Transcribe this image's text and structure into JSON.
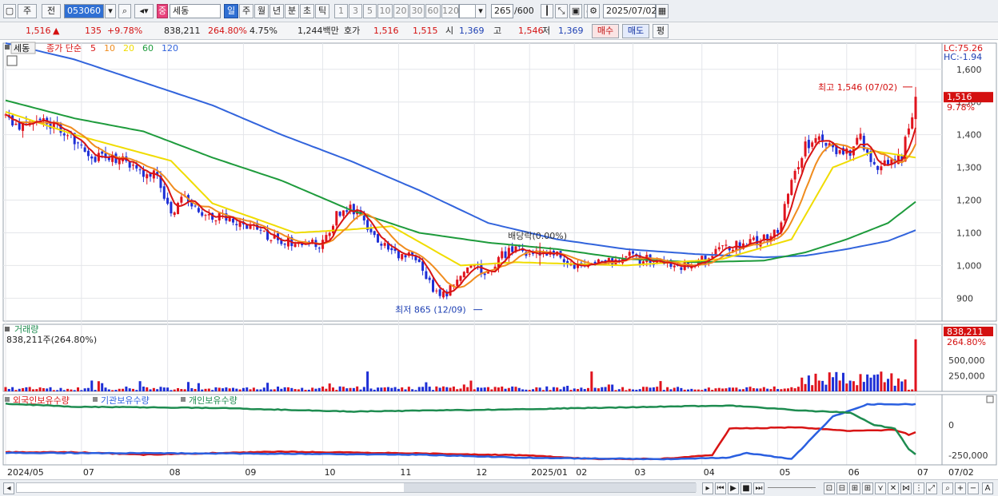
{
  "toolbar": {
    "period_label": "주",
    "all_label": "전",
    "code": "053060",
    "stock_name": "세동",
    "tf": [
      "일",
      "주",
      "월",
      "년",
      "분",
      "초",
      "틱"
    ],
    "tf_active": 0,
    "nums": [
      "1",
      "3",
      "5",
      "10",
      "20",
      "30",
      "60",
      "120"
    ],
    "count": "265",
    "count_total": "/600",
    "date": "2025/07/02"
  },
  "info": {
    "price": "1,516",
    "change_arrow": "▲",
    "change": "135",
    "change_pct": "+9.78%",
    "volume": "838,211",
    "vol_ratio": "264.80%",
    "turnover": "4.75%",
    "amount": "1,244백만",
    "quote_label": "호가",
    "ask": "1,516",
    "bid": "1,515",
    "open_label": "시",
    "open": "1,369",
    "high_label": "고",
    "high": "1,546",
    "low_label": "저",
    "low": "1,369",
    "buy_label": "매수",
    "sell_label": "매도",
    "flat_label": "평"
  },
  "colors": {
    "candle_up": "#e0141e",
    "candle_down": "#1e2fd6",
    "ma5": "#d81414",
    "ma10": "#f08c1e",
    "ma20": "#f0dc00",
    "ma60": "#1e9b3c",
    "ma120": "#3264dc",
    "foreign": "#d81414",
    "institution": "#2a5fe0",
    "individual": "#1e8c50"
  },
  "chart_data": [
    {
      "type": "candlestick",
      "legend": {
        "stock": "세동",
        "ma_title": "종가 단순",
        "ma": [
          "5",
          "10",
          "20",
          "60",
          "120"
        ]
      },
      "right_top_labels": [
        "LC:75.26",
        "HC:-1.94"
      ],
      "ylim": [
        830,
        1680
      ],
      "y_ticks": [
        900,
        1000,
        1100,
        1200,
        1300,
        1400,
        1500,
        1600
      ],
      "y_tick_labels": [
        "900",
        "1,000",
        "1,100",
        "1,200",
        "1,300",
        "1,400",
        "1,500",
        "1,600"
      ],
      "current_price": {
        "label": "1,516",
        "pct": "9.78%",
        "value": 1516
      },
      "annotations": {
        "high": "최고 1,546 (07/02)",
        "low": "최저 865 (12/09)",
        "dividend": "배당락(0.00%)"
      },
      "price_path": [
        [
          0,
          1450
        ],
        [
          4,
          1430
        ],
        [
          8,
          1460
        ],
        [
          12,
          1440
        ],
        [
          16,
          1420
        ],
        [
          20,
          1380
        ],
        [
          24,
          1320
        ],
        [
          28,
          1340
        ],
        [
          32,
          1330
        ],
        [
          36,
          1310
        ],
        [
          40,
          1290
        ],
        [
          44,
          1280
        ],
        [
          48,
          1150
        ],
        [
          52,
          1220
        ],
        [
          56,
          1160
        ],
        [
          60,
          1150
        ],
        [
          64,
          1145
        ],
        [
          68,
          1130
        ],
        [
          72,
          1120
        ],
        [
          76,
          1090
        ],
        [
          80,
          1080
        ],
        [
          84,
          1070
        ],
        [
          88,
          1070
        ],
        [
          92,
          1065
        ],
        [
          96,
          1150
        ],
        [
          100,
          1170
        ],
        [
          104,
          1140
        ],
        [
          108,
          1070
        ],
        [
          112,
          1040
        ],
        [
          116,
          1030
        ],
        [
          120,
          1020
        ],
        [
          124,
          920
        ],
        [
          128,
          910
        ],
        [
          132,
          980
        ],
        [
          136,
          990
        ],
        [
          140,
          980
        ],
        [
          144,
          1030
        ],
        [
          148,
          1050
        ],
        [
          152,
          1040
        ],
        [
          156,
          1040
        ],
        [
          160,
          1030
        ],
        [
          164,
          1000
        ],
        [
          168,
          1000
        ],
        [
          172,
          1005
        ],
        [
          176,
          1010
        ],
        [
          180,
          1030
        ],
        [
          184,
          1020
        ],
        [
          188,
          1015
        ],
        [
          192,
          1010
        ],
        [
          196,
          1000
        ],
        [
          200,
          1010
        ],
        [
          204,
          1020
        ],
        [
          208,
          1050
        ],
        [
          212,
          1060
        ],
        [
          216,
          1070
        ],
        [
          220,
          1080
        ],
        [
          224,
          1100
        ],
        [
          228,
          1280
        ],
        [
          232,
          1360
        ],
        [
          236,
          1390
        ],
        [
          240,
          1350
        ],
        [
          244,
          1340
        ],
        [
          248,
          1390
        ],
        [
          252,
          1300
        ],
        [
          256,
          1320
        ],
        [
          260,
          1330
        ],
        [
          264,
          1516
        ]
      ],
      "ma20": [
        [
          0,
          1470
        ],
        [
          20,
          1400
        ],
        [
          48,
          1320
        ],
        [
          60,
          1190
        ],
        [
          84,
          1100
        ],
        [
          100,
          1110
        ],
        [
          112,
          1120
        ],
        [
          132,
          1000
        ],
        [
          148,
          1010
        ],
        [
          180,
          1000
        ],
        [
          208,
          1020
        ],
        [
          228,
          1080
        ],
        [
          240,
          1300
        ],
        [
          252,
          1350
        ],
        [
          264,
          1330
        ]
      ],
      "ma60": [
        [
          0,
          1505
        ],
        [
          20,
          1450
        ],
        [
          40,
          1410
        ],
        [
          60,
          1330
        ],
        [
          80,
          1260
        ],
        [
          100,
          1170
        ],
        [
          120,
          1100
        ],
        [
          140,
          1070
        ],
        [
          160,
          1050
        ],
        [
          180,
          1020
        ],
        [
          200,
          1010
        ],
        [
          220,
          1015
        ],
        [
          232,
          1040
        ],
        [
          244,
          1080
        ],
        [
          256,
          1130
        ],
        [
          264,
          1195
        ]
      ],
      "ma120": [
        [
          0,
          1680
        ],
        [
          20,
          1630
        ],
        [
          40,
          1560
        ],
        [
          60,
          1490
        ],
        [
          80,
          1400
        ],
        [
          100,
          1320
        ],
        [
          120,
          1230
        ],
        [
          140,
          1130
        ],
        [
          160,
          1080
        ],
        [
          180,
          1050
        ],
        [
          200,
          1035
        ],
        [
          220,
          1025
        ],
        [
          232,
          1030
        ],
        [
          244,
          1050
        ],
        [
          256,
          1075
        ],
        [
          264,
          1108
        ]
      ]
    },
    {
      "type": "bar",
      "title": "거래량",
      "label": "838,211주(264.80%)",
      "current_label": "838,211",
      "current_pct": "264.80%",
      "ylim": [
        0,
        900000
      ],
      "y_ticks": [
        250000,
        500000
      ],
      "y_tick_labels": [
        "250,000",
        "500,000"
      ],
      "last_value": 838211
    },
    {
      "type": "line",
      "series": [
        {
          "name": "외국인보유수량"
        },
        {
          "name": "기관보유수량"
        },
        {
          "name": "개인보유수량"
        }
      ],
      "y_ticks": [
        0,
        -250000
      ],
      "y_tick_labels": [
        "0",
        "-250,000"
      ],
      "x_labels": [
        "2024/05",
        "07",
        "08",
        "09",
        "10",
        "11",
        "12",
        "2025/01",
        "02",
        "03",
        "04",
        "05",
        "06",
        "07"
      ],
      "x_label_right": "07/02"
    }
  ]
}
